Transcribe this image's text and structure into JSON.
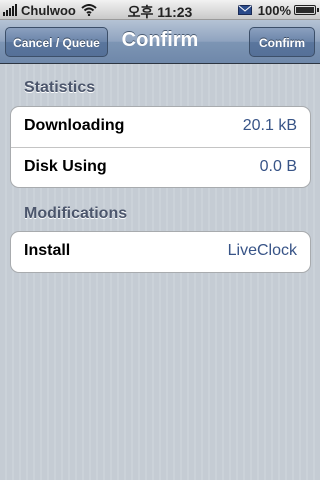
{
  "status_bar": {
    "carrier": "Chulwoo",
    "time": "오후 11:23",
    "battery": "100%",
    "signal_icon": "signal-bars-icon",
    "wifi_icon": "wifi-icon",
    "mail_icon": "mail-icon",
    "battery_icon": "battery-charging-icon"
  },
  "nav": {
    "left_button": "Cancel / Queue",
    "title": "Confirm",
    "right_button": "Confirm"
  },
  "sections": [
    {
      "header": "Statistics",
      "rows": [
        {
          "label": "Downloading",
          "value": "20.1 kB"
        },
        {
          "label": "Disk Using",
          "value": "0.0 B"
        }
      ]
    },
    {
      "header": "Modifications",
      "rows": [
        {
          "label": "Install",
          "value": "LiveClock"
        }
      ]
    }
  ],
  "colors": {
    "nav_bar": "#7d95b4",
    "section_header": "#4c566c",
    "value_text": "#385487"
  }
}
